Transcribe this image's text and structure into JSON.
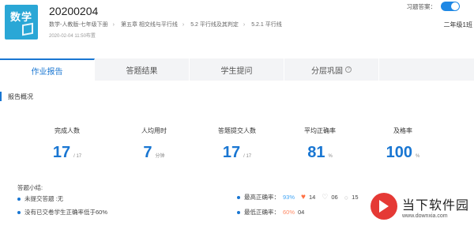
{
  "header": {
    "subject_icon_text": "数学",
    "title": "20200204",
    "breadcrumb": [
      "数学-人教版-七年级下册",
      "第五章 相交线与平行线",
      "5.2 平行线及其判定",
      "5.2.1 平行线"
    ],
    "publish_time": "2020-02-04 11:50布置",
    "answer_label": "习题答案：",
    "answer_toggle_on": true,
    "class_name": "二年级1班"
  },
  "tabs": [
    {
      "label": "作业报告",
      "active": true
    },
    {
      "label": "答题结果",
      "active": false
    },
    {
      "label": "学生提问",
      "active": false
    },
    {
      "label": "分层巩固",
      "active": false,
      "icon": "help-icon",
      "icon_glyph": "?"
    }
  ],
  "overview": {
    "title": "报告概况",
    "stats": [
      {
        "label": "完成人数",
        "value": "17",
        "unit": "/ 17"
      },
      {
        "label": "人均用时",
        "value": "7",
        "unit": "分钟"
      },
      {
        "label": "答题提交人数",
        "value": "17",
        "unit": "/ 17"
      },
      {
        "label": "平均正确率",
        "value": "81",
        "unit": "%"
      },
      {
        "label": "及格率",
        "value": "100",
        "unit": "%"
      }
    ]
  },
  "summary": {
    "title": "答题小结:",
    "left_items": [
      "未提交答题 :无",
      "没有已交卷学生正确率低于60%"
    ],
    "highest_label": "最高正确率：",
    "highest_value": "93%",
    "highest_counts": [
      "14",
      "06",
      "15"
    ],
    "lowest_label": "最低正确率：",
    "lowest_value": "60%",
    "lowest_count": "04"
  },
  "watermark": {
    "text": "当下软件园",
    "url": "www.downxia.com"
  },
  "colors": {
    "accent": "#1976d2",
    "orange": "#ff8a65",
    "subject_icon": "#2aa7d6"
  }
}
